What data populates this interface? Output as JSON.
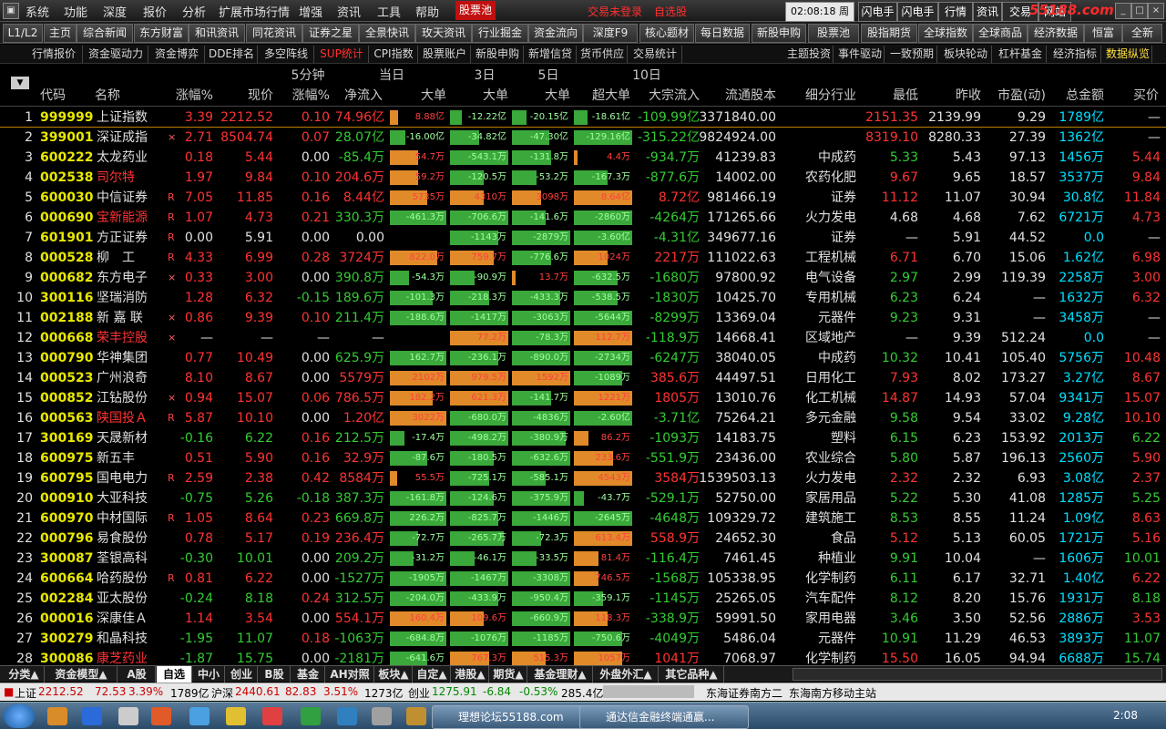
{
  "menu": [
    "系统",
    "功能",
    "深度",
    "报价",
    "分析",
    "扩展市场行情",
    "增强",
    "资讯",
    "工具",
    "帮助"
  ],
  "menu_x": [
    28,
    70,
    113,
    157,
    200,
    240,
    328,
    370,
    414,
    456
  ],
  "stock_pool_tab": "股票池",
  "login_status": "交易未登录",
  "watchlist": "自选股",
  "clock": "02:08:18 周二",
  "right_tabs": [
    "闪电手",
    "闪电手",
    "行情",
    "资讯",
    "交易",
    "网站"
  ],
  "watermark": "55188.com",
  "toolbar": [
    "L1/L2",
    "主页",
    "综合新闻",
    "东方财富",
    "和讯资讯",
    "同花资讯",
    "证券之星",
    "全景快讯",
    "玫天资讯",
    "行业掘金",
    "资金流向",
    "深度F9",
    "核心题材",
    "每日数据",
    "新股申购",
    "股票池",
    "股指期货",
    "全球指数",
    "全球商品",
    "经济数据",
    "恒富",
    "全新"
  ],
  "subtabs_left": [
    "行情报价",
    "资金驱动力",
    "资金博弈",
    "DDE排名",
    "多空阵线",
    "SUP统计",
    "CPI指数",
    "股票账户",
    "新股申购",
    "新增信贷",
    "货币供应",
    "交易统计"
  ],
  "subtabs_right": [
    "主题投资",
    "事件驱动",
    "一致预期",
    "板块轮动",
    "杠杆基金",
    "经济指标",
    "数据纵览"
  ],
  "group_headers": {
    "min5": "5分钟",
    "today": "当日",
    "d3": "3日",
    "d5": "5日",
    "d10": "10日"
  },
  "columns": [
    "代码",
    "名称",
    "涨幅%",
    "现价",
    "涨幅%",
    "净流入",
    "大单",
    "大单",
    "大单",
    "超大单",
    "大宗流入",
    "流通股本",
    "细分行业",
    "最低",
    "昨收",
    "市盈(动)",
    "总金额",
    "买价"
  ],
  "rows": [
    {
      "n": "1",
      "code": "999999",
      "name": "上证指数",
      "mark": "",
      "chg": "3.39",
      "price": "2212.52",
      "m5": "0.10",
      "net": "74.96亿",
      "b1": "8.88亿",
      "b1v": 9,
      "b2": "-12.22亿",
      "b2v": -12,
      "b3": "-20.15亿",
      "b3v": -15,
      "b4": "-18.61亿",
      "b4v": -14,
      "block": "-109.99亿",
      "float": "3371840.00",
      "ind": "",
      "low": "2151.35",
      "prev": "2139.99",
      "pe": "9.29",
      "amt": "1789亿",
      "bid": "—",
      "cc": "r",
      "pc": "r",
      "mc": "r",
      "nc": "r",
      "lc": "r",
      "bc": "n"
    },
    {
      "n": "2",
      "code": "399001",
      "name": "深证成指",
      "mark": "×",
      "chg": "2.71",
      "price": "8504.74",
      "m5": "0.07",
      "net": "28.07亿",
      "b1": "-16.00亿",
      "b1v": -16,
      "b2": "-34.82亿",
      "b2v": -30,
      "b3": "-47.30亿",
      "b3v": -38,
      "b4": "-129.16亿",
      "b4v": -60,
      "block": "-315.22亿",
      "float": "9824924.00",
      "ind": "",
      "low": "8319.10",
      "prev": "8280.33",
      "pe": "27.39",
      "amt": "1362亿",
      "bid": "—",
      "cc": "r",
      "pc": "r",
      "mc": "r",
      "nc": "g",
      "lc": "r",
      "bc": "n"
    },
    {
      "n": "3",
      "code": "600222",
      "name": "太龙药业",
      "mark": "",
      "chg": "0.18",
      "price": "5.44",
      "m5": "0.00",
      "net": "-85.4万",
      "b1": "54.7万",
      "b1v": 30,
      "b2": "-543.1万",
      "b2v": -60,
      "b3": "-131.8万",
      "b3v": -40,
      "b4": "4.4万",
      "b4v": 2,
      "block": "-934.7万",
      "float": "41239.83",
      "ind": "中成药",
      "low": "5.33",
      "prev": "5.43",
      "pe": "97.13",
      "amt": "1456万",
      "bid": "5.44",
      "cc": "r",
      "pc": "r",
      "mc": "w",
      "nc": "g",
      "lc": "g",
      "bc": "r"
    },
    {
      "n": "4",
      "code": "002538",
      "name": "司尔特",
      "mark": "",
      "chg": "1.97",
      "price": "9.84",
      "m5": "0.10",
      "net": "204.6万",
      "b1": "59.2万",
      "b1v": 30,
      "b2": "-120.5万",
      "b2v": -35,
      "b3": "-53.2万",
      "b3v": -25,
      "b4": "-167.3万",
      "b4v": -35,
      "block": "-877.6万",
      "float": "14002.00",
      "ind": "农药化肥",
      "low": "9.67",
      "prev": "9.65",
      "pe": "18.57",
      "amt": "3537万",
      "bid": "9.84",
      "cc": "r",
      "pc": "r",
      "mc": "r",
      "nc": "r",
      "lc": "r",
      "bc": "r",
      "nameRed": true
    },
    {
      "n": "5",
      "code": "600030",
      "name": "中信证券",
      "mark": "R",
      "chg": "7.05",
      "price": "11.85",
      "m5": "0.16",
      "net": "8.44亿",
      "b1": "5735万",
      "b1v": 40,
      "b2": "4310万",
      "b2v": 35,
      "b3": "3098万",
      "b3v": 30,
      "b4": "8.64亿",
      "b4v": 60,
      "block": "8.72亿",
      "float": "981466.19",
      "ind": "证券",
      "low": "11.12",
      "prev": "11.07",
      "pe": "30.94",
      "amt": "30.8亿",
      "bid": "11.84",
      "cc": "r",
      "pc": "r",
      "mc": "r",
      "nc": "r",
      "lc": "r",
      "bc": "r"
    },
    {
      "n": "6",
      "code": "000690",
      "name": "宝新能源",
      "mark": "R",
      "chg": "1.07",
      "price": "4.73",
      "m5": "0.21",
      "net": "330.3万",
      "b1": "-461.3万",
      "b1v": -60,
      "b2": "-706.6万",
      "b2v": -60,
      "b3": "-141.6万",
      "b3v": -35,
      "b4": "-2860万",
      "b4v": -60,
      "block": "-4264万",
      "float": "171265.66",
      "ind": "火力发电",
      "low": "4.68",
      "prev": "4.68",
      "pe": "7.62",
      "amt": "6721万",
      "bid": "4.73",
      "cc": "r",
      "pc": "r",
      "mc": "r",
      "nc": "g",
      "lc": "w",
      "bc": "r",
      "nameRed": true
    },
    {
      "n": "7",
      "code": "601901",
      "name": "方正证券",
      "mark": "R",
      "chg": "0.00",
      "price": "5.91",
      "m5": "0.00",
      "net": "0.00",
      "b1": "",
      "b1v": 0,
      "b2": "-1143万",
      "b2v": -50,
      "b3": "-2879万",
      "b3v": -60,
      "b4": "-3.60亿",
      "b4v": -60,
      "block": "-4.31亿",
      "float": "349677.16",
      "ind": "证券",
      "low": "—",
      "prev": "5.91",
      "pe": "44.52",
      "amt": "0.0",
      "bid": "—",
      "cc": "w",
      "pc": "w",
      "mc": "w",
      "nc": "w",
      "lc": "w",
      "bc": "n"
    },
    {
      "n": "8",
      "code": "000528",
      "name": "柳　工",
      "mark": "R",
      "chg": "4.33",
      "price": "6.99",
      "m5": "0.28",
      "net": "3724万",
      "b1": "822.0万",
      "b1v": 50,
      "b2": "759.7万",
      "b2v": 45,
      "b3": "-776.6万",
      "b3v": -40,
      "b4": "1024万",
      "b4v": 35,
      "block": "2217万",
      "float": "111022.63",
      "ind": "工程机械",
      "low": "6.71",
      "prev": "6.70",
      "pe": "15.06",
      "amt": "1.62亿",
      "bid": "6.98",
      "cc": "r",
      "pc": "r",
      "mc": "r",
      "nc": "r",
      "lc": "r",
      "bc": "r"
    },
    {
      "n": "9",
      "code": "000682",
      "name": "东方电子",
      "mark": "×",
      "chg": "0.33",
      "price": "3.00",
      "m5": "0.00",
      "net": "390.8万",
      "b1": "-54.3万",
      "b1v": -20,
      "b2": "-90.9万",
      "b2v": -25,
      "b3": "13.7万",
      "b3v": 3,
      "b4": "-632.5万",
      "b4v": -45,
      "block": "-1680万",
      "float": "97800.92",
      "ind": "电气设备",
      "low": "2.97",
      "prev": "2.99",
      "pe": "119.39",
      "amt": "2258万",
      "bid": "3.00",
      "cc": "r",
      "pc": "r",
      "mc": "w",
      "nc": "g",
      "lc": "g",
      "bc": "r"
    },
    {
      "n": "10",
      "code": "300116",
      "name": "坚瑞消防",
      "mark": "",
      "chg": "1.28",
      "price": "6.32",
      "m5": "-0.15",
      "net": "189.6万",
      "b1": "-101.3万",
      "b1v": -45,
      "b2": "-218.3万",
      "b2v": -40,
      "b3": "-433.3万",
      "b3v": -50,
      "b4": "-538.5万",
      "b4v": -45,
      "block": "-1830万",
      "float": "10425.70",
      "ind": "专用机械",
      "low": "6.23",
      "prev": "6.24",
      "pe": "—",
      "amt": "1632万",
      "bid": "6.32",
      "cc": "r",
      "pc": "r",
      "mc": "g",
      "nc": "g",
      "lc": "g",
      "bc": "r"
    },
    {
      "n": "11",
      "code": "002188",
      "name": "新 嘉 联",
      "mark": "×",
      "chg": "0.86",
      "price": "9.39",
      "m5": "0.10",
      "net": "211.4万",
      "b1": "-188.6万",
      "b1v": -60,
      "b2": "-1417万",
      "b2v": -60,
      "b3": "-3063万",
      "b3v": -60,
      "b4": "-5644万",
      "b4v": -60,
      "block": "-8299万",
      "float": "13369.04",
      "ind": "元器件",
      "low": "9.23",
      "prev": "9.31",
      "pe": "—",
      "amt": "3458万",
      "bid": "—",
      "cc": "r",
      "pc": "r",
      "mc": "r",
      "nc": "g",
      "lc": "g",
      "bc": "n"
    },
    {
      "n": "12",
      "code": "000668",
      "name": "荣丰控股",
      "mark": "×",
      "chg": "—",
      "price": "—",
      "m5": "—",
      "net": "—",
      "b1": "",
      "b1v": 0,
      "b2": "77.2万",
      "b2v": 60,
      "b3": "-78.3万",
      "b3v": -60,
      "b4": "112.7万",
      "b4v": 60,
      "block": "-118.9万",
      "float": "14668.41",
      "ind": "区域地产",
      "low": "—",
      "prev": "9.39",
      "pe": "512.24",
      "amt": "0.0",
      "bid": "—",
      "cc": "w",
      "pc": "w",
      "mc": "w",
      "nc": "w",
      "lc": "w",
      "bc": "n",
      "nameRed": true
    },
    {
      "n": "13",
      "code": "000790",
      "name": "华神集团",
      "mark": "",
      "chg": "0.77",
      "price": "10.49",
      "m5": "0.00",
      "net": "625.9万",
      "b1": "162.7万",
      "b1v": -60,
      "b2": "-236.1万",
      "b2v": -50,
      "b3": "-890.0万",
      "b3v": -60,
      "b4": "-2734万",
      "b4v": -60,
      "block": "-6247万",
      "float": "38040.05",
      "ind": "中成药",
      "low": "10.32",
      "prev": "10.41",
      "pe": "105.40",
      "amt": "5756万",
      "bid": "10.48",
      "cc": "r",
      "pc": "r",
      "mc": "w",
      "nc": "g",
      "lc": "g",
      "bc": "r"
    },
    {
      "n": "14",
      "code": "000523",
      "name": "广州浪奇",
      "mark": "",
      "chg": "8.10",
      "price": "8.67",
      "m5": "0.00",
      "net": "5579万",
      "b1": "2102万",
      "b1v": 60,
      "b2": "979.5万",
      "b2v": 60,
      "b3": "1592万",
      "b3v": 60,
      "b4": "-1089万",
      "b4v": -50,
      "block": "385.6万",
      "float": "44497.51",
      "ind": "日用化工",
      "low": "7.93",
      "prev": "8.02",
      "pe": "173.27",
      "amt": "3.27亿",
      "bid": "8.67",
      "cc": "r",
      "pc": "r",
      "mc": "w",
      "nc": "r",
      "lc": "r",
      "bc": "r"
    },
    {
      "n": "15",
      "code": "000852",
      "name": "江钻股份",
      "mark": "×",
      "chg": "0.94",
      "price": "15.07",
      "m5": "0.06",
      "net": "786.5万",
      "b1": "182.2万",
      "b1v": 45,
      "b2": "621.3万",
      "b2v": 60,
      "b3": "-141.7万",
      "b3v": -40,
      "b4": "1221万",
      "b4v": 60,
      "block": "1805万",
      "float": "13010.76",
      "ind": "化工机械",
      "low": "14.87",
      "prev": "14.93",
      "pe": "57.04",
      "amt": "9341万",
      "bid": "15.07",
      "cc": "r",
      "pc": "r",
      "mc": "r",
      "nc": "r",
      "lc": "r",
      "bc": "r"
    },
    {
      "n": "16",
      "code": "000563",
      "name": "陕国投Ａ",
      "mark": "R",
      "chg": "5.87",
      "price": "10.10",
      "m5": "0.00",
      "net": "1.20亿",
      "b1": "3022万",
      "b1v": 60,
      "b2": "-680.0万",
      "b2v": -60,
      "b3": "-4836万",
      "b3v": -60,
      "b4": "-2.60亿",
      "b4v": -60,
      "block": "-3.71亿",
      "float": "75264.21",
      "ind": "多元金融",
      "low": "9.58",
      "prev": "9.54",
      "pe": "33.02",
      "amt": "9.28亿",
      "bid": "10.10",
      "cc": "r",
      "pc": "r",
      "mc": "w",
      "nc": "r",
      "lc": "g",
      "bc": "r",
      "nameRed": true
    },
    {
      "n": "17",
      "code": "300169",
      "name": "天晟新材",
      "mark": "",
      "chg": "-0.16",
      "price": "6.22",
      "m5": "0.16",
      "net": "212.5万",
      "b1": "-17.4万",
      "b1v": -15,
      "b2": "-498.2万",
      "b2v": -60,
      "b3": "-380.9万",
      "b3v": -55,
      "b4": "86.2万",
      "b4v": 15,
      "block": "-1093万",
      "float": "14183.75",
      "ind": "塑料",
      "low": "6.15",
      "prev": "6.23",
      "pe": "153.92",
      "amt": "2013万",
      "bid": "6.22",
      "cc": "g",
      "pc": "g",
      "mc": "r",
      "nc": "g",
      "lc": "g",
      "bc": "g"
    },
    {
      "n": "18",
      "code": "600975",
      "name": "新五丰",
      "mark": "",
      "chg": "0.51",
      "price": "5.90",
      "m5": "0.16",
      "net": "32.9万",
      "b1": "-87.6万",
      "b1v": -40,
      "b2": "-180.5万",
      "b2v": -45,
      "b3": "-632.6万",
      "b3v": -60,
      "b4": "233.6万",
      "b4v": 40,
      "block": "-551.9万",
      "float": "23436.00",
      "ind": "农业综合",
      "low": "5.80",
      "prev": "5.87",
      "pe": "196.13",
      "amt": "2560万",
      "bid": "5.90",
      "cc": "r",
      "pc": "r",
      "mc": "r",
      "nc": "r",
      "lc": "g",
      "bc": "r"
    },
    {
      "n": "19",
      "code": "600795",
      "name": "国电电力",
      "mark": "R",
      "chg": "2.59",
      "price": "2.38",
      "m5": "0.42",
      "net": "8584万",
      "b1": "55.5万",
      "b1v": 8,
      "b2": "-725.1万",
      "b2v": -40,
      "b3": "-585.1万",
      "b3v": -35,
      "b4": "4543万",
      "b4v": 60,
      "block": "3584万",
      "float": "1539503.13",
      "ind": "火力发电",
      "low": "2.32",
      "prev": "2.32",
      "pe": "6.93",
      "amt": "3.08亿",
      "bid": "2.37",
      "cc": "r",
      "pc": "r",
      "mc": "r",
      "nc": "r",
      "lc": "r",
      "bc": "r"
    },
    {
      "n": "20",
      "code": "000910",
      "name": "大亚科技",
      "mark": "",
      "chg": "-0.75",
      "price": "5.26",
      "m5": "-0.18",
      "net": "387.3万",
      "b1": "-161.8万",
      "b1v": -60,
      "b2": "-124.6万",
      "b2v": -45,
      "b3": "-375.9万",
      "b3v": -60,
      "b4": "-43.7万",
      "b4v": -10,
      "block": "-529.1万",
      "float": "52750.00",
      "ind": "家居用品",
      "low": "5.22",
      "prev": "5.30",
      "pe": "41.08",
      "amt": "1285万",
      "bid": "5.25",
      "cc": "g",
      "pc": "g",
      "mc": "g",
      "nc": "g",
      "lc": "g",
      "bc": "g"
    },
    {
      "n": "21",
      "code": "600970",
      "name": "中材国际",
      "mark": "R",
      "chg": "1.05",
      "price": "8.64",
      "m5": "0.23",
      "net": "669.8万",
      "b1": "226.2万",
      "b1v": -60,
      "b2": "-825.7万",
      "b2v": -50,
      "b3": "-1446万",
      "b3v": -60,
      "b4": "-2645万",
      "b4v": -60,
      "block": "-4648万",
      "float": "109329.72",
      "ind": "建筑施工",
      "low": "8.53",
      "prev": "8.55",
      "pe": "11.24",
      "amt": "1.09亿",
      "bid": "8.63",
      "cc": "r",
      "pc": "r",
      "mc": "r",
      "nc": "g",
      "lc": "g",
      "bc": "r"
    },
    {
      "n": "22",
      "code": "000796",
      "name": "易食股份",
      "mark": "",
      "chg": "0.78",
      "price": "5.17",
      "m5": "0.19",
      "net": "236.4万",
      "b1": "-72.7万",
      "b1v": -30,
      "b2": "-265.7万",
      "b2v": -55,
      "b3": "-72.3万",
      "b3v": -30,
      "b4": "613.4万",
      "b4v": 60,
      "block": "558.9万",
      "float": "24652.30",
      "ind": "食品",
      "low": "5.12",
      "prev": "5.13",
      "pe": "60.05",
      "amt": "1721万",
      "bid": "5.16",
      "cc": "r",
      "pc": "r",
      "mc": "r",
      "nc": "r",
      "lc": "r",
      "bc": "r"
    },
    {
      "n": "23",
      "code": "300087",
      "name": "荃银高科",
      "mark": "",
      "chg": "-0.30",
      "price": "10.01",
      "m5": "0.00",
      "net": "209.2万",
      "b1": "-31.2万",
      "b1v": -25,
      "b2": "-46.1万",
      "b2v": -25,
      "b3": "-33.5万",
      "b3v": -25,
      "b4": "81.4万",
      "b4v": 25,
      "block": "-116.4万",
      "float": "7461.45",
      "ind": "种植业",
      "low": "9.91",
      "prev": "10.04",
      "pe": "—",
      "amt": "1606万",
      "bid": "10.01",
      "cc": "g",
      "pc": "g",
      "mc": "w",
      "nc": "g",
      "lc": "g",
      "bc": "g"
    },
    {
      "n": "24",
      "code": "600664",
      "name": "哈药股份",
      "mark": "R",
      "chg": "0.81",
      "price": "6.22",
      "m5": "0.00",
      "net": "-1527万",
      "b1": "-1905万",
      "b1v": -60,
      "b2": "-1467万",
      "b2v": -60,
      "b3": "-3308万",
      "b3v": -60,
      "b4": "746.5万",
      "b4v": 25,
      "block": "-1568万",
      "float": "105338.95",
      "ind": "化学制药",
      "low": "6.11",
      "prev": "6.17",
      "pe": "32.71",
      "amt": "1.40亿",
      "bid": "6.22",
      "cc": "r",
      "pc": "r",
      "mc": "w",
      "nc": "g",
      "lc": "g",
      "bc": "r"
    },
    {
      "n": "25",
      "code": "002284",
      "name": "亚太股份",
      "mark": "",
      "chg": "-0.24",
      "price": "8.18",
      "m5": "0.24",
      "net": "312.5万",
      "b1": "-204.0万",
      "b1v": -60,
      "b2": "-433.9万",
      "b2v": -50,
      "b3": "-950.4万",
      "b3v": -60,
      "b4": "-359.1万",
      "b4v": -30,
      "block": "-1145万",
      "float": "25265.05",
      "ind": "汽车配件",
      "low": "8.12",
      "prev": "8.20",
      "pe": "15.76",
      "amt": "1931万",
      "bid": "8.18",
      "cc": "g",
      "pc": "g",
      "mc": "r",
      "nc": "g",
      "lc": "g",
      "bc": "g"
    },
    {
      "n": "26",
      "code": "000016",
      "name": "深康佳Ａ",
      "mark": "",
      "chg": "1.14",
      "price": "3.54",
      "m5": "0.00",
      "net": "554.1万",
      "b1": "160.4万",
      "b1v": 60,
      "b2": "109.6万",
      "b2v": 35,
      "b3": "-660.9万",
      "b3v": -60,
      "b4": "118.3万",
      "b4v": 35,
      "block": "-338.9万",
      "float": "59991.50",
      "ind": "家用电器",
      "low": "3.46",
      "prev": "3.50",
      "pe": "52.56",
      "amt": "2886万",
      "bid": "3.53",
      "cc": "r",
      "pc": "r",
      "mc": "w",
      "nc": "r",
      "lc": "g",
      "bc": "r"
    },
    {
      "n": "27",
      "code": "300279",
      "name": "和晶科技",
      "mark": "",
      "chg": "-1.95",
      "price": "11.07",
      "m5": "0.18",
      "net": "-1063万",
      "b1": "-684.8万",
      "b1v": -60,
      "b2": "-1076万",
      "b2v": -60,
      "b3": "-1185万",
      "b3v": -60,
      "b4": "-750.6万",
      "b4v": -50,
      "block": "-4049万",
      "float": "5486.04",
      "ind": "元器件",
      "low": "10.91",
      "prev": "11.29",
      "pe": "46.53",
      "amt": "3893万",
      "bid": "11.07",
      "cc": "g",
      "pc": "g",
      "mc": "r",
      "nc": "g",
      "lc": "g",
      "bc": "g"
    },
    {
      "n": "28",
      "code": "300086",
      "name": "康芝药业",
      "mark": "",
      "chg": "-1.87",
      "price": "15.75",
      "m5": "0.00",
      "net": "-2181万",
      "b1": "-641.6万",
      "b1v": -40,
      "b2": "767.3万",
      "b2v": 40,
      "b3": "515.3万",
      "b3v": 35,
      "b4": "1057万",
      "b4v": 50,
      "block": "1041万",
      "float": "7068.97",
      "ind": "化学制药",
      "low": "15.50",
      "prev": "16.05",
      "pe": "94.94",
      "amt": "6688万",
      "bid": "15.74",
      "cc": "g",
      "pc": "g",
      "mc": "w",
      "nc": "g",
      "lc": "r",
      "bc": "g",
      "nameRed": true
    }
  ],
  "bottom_tabs": [
    "分类▲",
    "资金模型▲",
    "A股",
    "自选",
    "中小",
    "创业",
    "B股",
    "基金",
    "AH对照",
    "板块▲",
    "自定▲",
    "港股▲",
    "期货▲",
    "基金理财▲",
    "外盘外汇▲",
    "其它品种▲"
  ],
  "status": {
    "sh_label": "上证",
    "sh_val": "2212.52",
    "sh_chg": "72.53",
    "sh_pct": "3.39%",
    "sh_amt": "1789亿",
    "sz_label": "沪深",
    "sz_val": "2440.61",
    "sz_chg": "82.83",
    "sz_pct": "3.51%",
    "sz_amt": "1273亿",
    "cy_label": "创业",
    "cy_val": "1275.91",
    "cy_chg": "-6.84",
    "cy_pct": "-0.53%",
    "cy_amt": "285.4亿",
    "broker": "东海证券南方二",
    "server": "东海南方移动主站"
  },
  "taskbar": {
    "task1": "理想论坛55188.com",
    "task2": "通达信金融终端通赢...",
    "time": "2:08"
  },
  "colors": {
    "up": "#ff3333",
    "down": "#33cc33",
    "neutral": "#e0e0e0",
    "code": "#e8e800",
    "amount": "#00e0ff",
    "bar_pos": "#e08a2a",
    "bar_neg": "#3aa83a"
  }
}
